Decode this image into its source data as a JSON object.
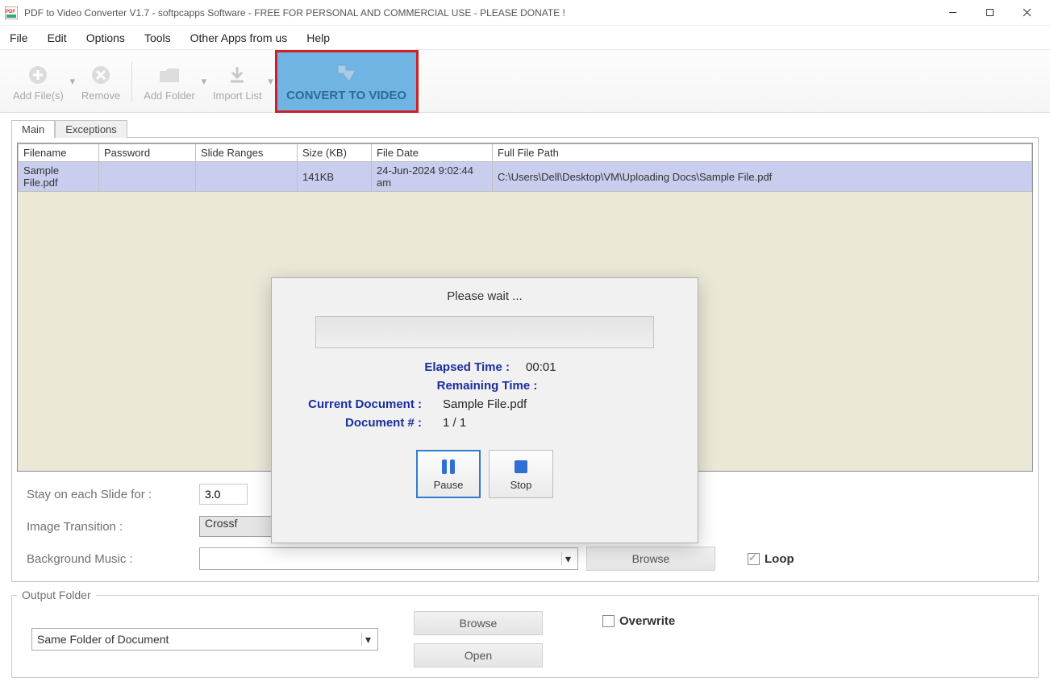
{
  "window": {
    "title": "PDF to Video Converter V1.7 - softpcapps Software - FREE FOR PERSONAL AND COMMERCIAL USE - PLEASE DONATE !"
  },
  "menu": {
    "file": "File",
    "edit": "Edit",
    "options": "Options",
    "tools": "Tools",
    "other_apps": "Other Apps from us",
    "help": "Help"
  },
  "toolbar": {
    "add_files": "Add File(s)",
    "remove": "Remove",
    "add_folder": "Add Folder",
    "import_list": "Import List",
    "convert": "CONVERT TO VIDEO"
  },
  "tabs": {
    "main": "Main",
    "exceptions": "Exceptions"
  },
  "table": {
    "headers": {
      "filename": "Filename",
      "password": "Password",
      "slide_ranges": "Slide Ranges",
      "size": "Size (KB)",
      "file_date": "File Date",
      "full_path": "Full File Path"
    },
    "rows": [
      {
        "filename": "Sample File.pdf",
        "password": "",
        "slide_ranges": "",
        "size": "141KB",
        "file_date": "24-Jun-2024 9:02:44 am",
        "full_path": "C:\\Users\\Dell\\Desktop\\VM\\Uploading Docs\\Sample File.pdf"
      }
    ]
  },
  "settings": {
    "stay_label": "Stay on each Slide for :",
    "stay_value": "3.0",
    "transition_label": "Image Transition :",
    "transition_value": "Crossf",
    "bgmusic_label": "Background Music :",
    "bgmusic_value": "",
    "browse": "Browse",
    "loop": "Loop"
  },
  "output": {
    "legend": "Output Folder",
    "folder_value": "Same Folder of Document",
    "browse": "Browse",
    "open": "Open",
    "overwrite": "Overwrite"
  },
  "dialog": {
    "title": "Please wait ...",
    "elapsed_label": "Elapsed Time :",
    "elapsed_value": "00:01",
    "remaining_label": "Remaining Time :",
    "remaining_value": "",
    "current_doc_label": "Current Document :",
    "current_doc_value": "Sample File.pdf",
    "doc_num_label": "Document # :",
    "doc_num_value": "1 / 1",
    "pause": "Pause",
    "stop": "Stop"
  }
}
